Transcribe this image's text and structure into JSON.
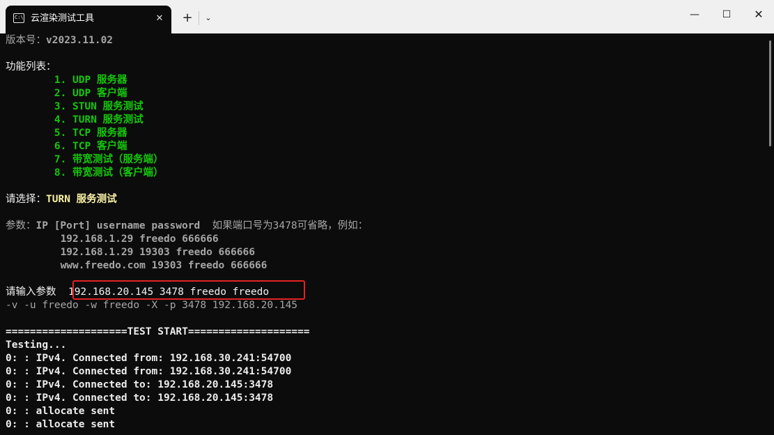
{
  "window": {
    "tab_title": "云渲染测试工具",
    "tab_icon_glyph": "C:\\",
    "close_tab_glyph": "✕",
    "new_tab_glyph": "+",
    "dropdown_glyph": "⌄",
    "minimize_glyph": "—",
    "maximize_glyph": "☐",
    "close_glyph": "✕"
  },
  "terminal": {
    "version_label": "版本号：",
    "version": "v2023.11.02",
    "feature_list_label": "功能列表：",
    "menu_items": [
      "1. UDP 服务器",
      "2. UDP 客户端",
      "3. STUN 服务测试",
      "4. TURN 服务测试",
      "5. TCP 服务器",
      "6. TCP 客户端",
      "7. 带宽测试（服务端）",
      "8. 带宽测试（客户端）"
    ],
    "choice_label": "请选择：",
    "choice_value": "TURN 服务测试",
    "params_label": "参数：",
    "params_syntax": "IP [Port] username password",
    "params_hint": "如果端口号为3478可省略，例如：",
    "examples": [
      "192.168.1.29 freedo 666666",
      "192.168.1.29 19303 freedo 666666",
      "www.freedo.com 19303 freedo 666666"
    ],
    "input_prompt": "请输入参数",
    "input_value": "192.168.20.145 3478 freedo freedo",
    "command_echo": "-v -u freedo -w freedo -X -p 3478 192.168.20.145",
    "separator": "====================TEST START====================",
    "log": [
      "Testing...",
      "0: : IPv4. Connected from: 192.168.30.241:54700",
      "0: : IPv4. Connected from: 192.168.30.241:54700",
      "0: : IPv4. Connected to: 192.168.20.145:3478",
      "0: : IPv4. Connected to: 192.168.20.145:3478",
      "0: : allocate sent",
      "0: : allocate sent"
    ]
  },
  "colors": {
    "background": "#0c0c0c",
    "menu_green": "#16c60c",
    "choice_yellow": "#f9f1a5",
    "highlight_red": "#e52222",
    "titlebar": "#f0f0f0"
  }
}
